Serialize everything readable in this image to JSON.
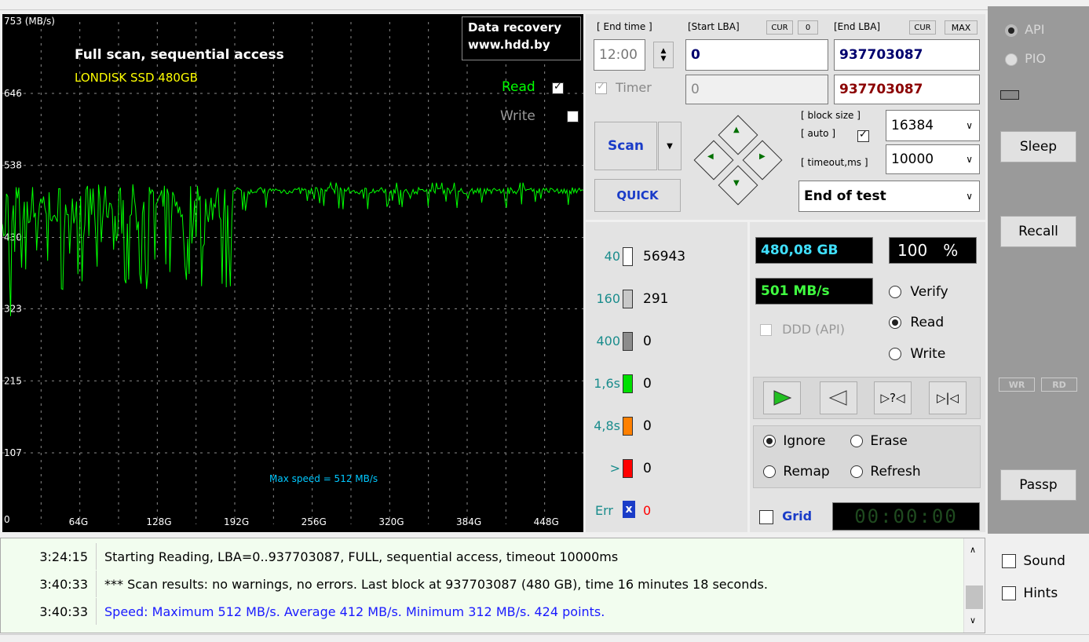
{
  "graph": {
    "y_unit_label": "753 (MB/s)",
    "y_ticks": [
      "646",
      "538",
      "430",
      "323",
      "215",
      "107",
      "0"
    ],
    "x_ticks": [
      "64G",
      "128G",
      "192G",
      "256G",
      "320G",
      "384G",
      "448G"
    ],
    "title": "Full scan, sequential access",
    "drive": "LONDISK SSD 480GB",
    "brand_line1": "Data recovery",
    "brand_line2": "www.hdd.by",
    "read_label": "Read",
    "write_label": "Write",
    "read_checked": true,
    "write_checked": false,
    "max_speed_text": "Max speed = 512 MB/s",
    "colors": {
      "line": "#00ff00",
      "grid": "#8a8a8a",
      "title": "#ffffff",
      "drive": "#ffff00",
      "maxspeed": "#00c8ff"
    }
  },
  "chart_data": {
    "type": "line",
    "xlim": [
      0,
      480
    ],
    "ylim": [
      0,
      753
    ],
    "max_speed": 512,
    "average_speed": 412,
    "min_speed": 312,
    "points": 424
  },
  "controls": {
    "end_time_label": "[ End time ]",
    "end_time_value": "12:00",
    "timer_label": "Timer",
    "start_lba_label": "[Start LBA]",
    "start_lba_cur": "CUR",
    "start_lba_zero": "0",
    "start_lba_value": "0",
    "start_lba_timer_value": "0",
    "end_lba_label": "[End LBA]",
    "end_lba_cur": "CUR",
    "end_lba_max": "MAX",
    "end_lba_value": "937703087",
    "end_lba_value2": "937703087",
    "block_size_label": "[ block size ]",
    "auto_label": "[ auto ]",
    "timeout_label": "[ timeout,ms ]",
    "block_size_value": "16384",
    "timeout_value": "10000",
    "scan_label": "Scan",
    "quick_label": "QUICK",
    "end_mode": "End of test"
  },
  "blocks": [
    {
      "label": "40",
      "count": "56943",
      "color": "#ffffff"
    },
    {
      "label": "160",
      "count": "291",
      "color": "#c8c8c8"
    },
    {
      "label": "400",
      "count": "0",
      "color": "#8c8c8c"
    },
    {
      "label": "1,6s",
      "count": "0",
      "color": "#00e000"
    },
    {
      "label": "4,8s",
      "count": "0",
      "color": "#ff8000"
    },
    {
      "label": ">",
      "count": "0",
      "color": "#ff0000"
    }
  ],
  "err": {
    "label": "Err",
    "count": "0"
  },
  "status": {
    "size": "480,08 GB",
    "percent": "100",
    "percent_sign": "%",
    "speed": "501 MB/s",
    "ddd_label": "DDD (API)",
    "verify_label": "Verify",
    "read_label": "Read",
    "write_label": "Write",
    "ignore_label": "Ignore",
    "erase_label": "Erase",
    "remap_label": "Remap",
    "refresh_label": "Refresh",
    "grid_label": "Grid",
    "timer_display": "00:00:00"
  },
  "right_panel": {
    "api_label": "API",
    "pio_label": "PIO",
    "sleep_label": "Sleep",
    "recall_label": "Recall",
    "wr_label": "WR",
    "rd_label": "RD",
    "passp_label": "Passp",
    "sound_label": "Sound",
    "hints_label": "Hints"
  },
  "log": [
    {
      "time": "3:24:15",
      "msg": "Starting Reading, LBA=0..937703087, FULL, sequential access, timeout 10000ms",
      "color": "#000000"
    },
    {
      "time": "3:40:33",
      "msg": "*** Scan results: no warnings, no errors. Last block at 937703087 (480 GB), time 16 minutes 18 seconds.",
      "color": "#000000"
    },
    {
      "time": "3:40:33",
      "msg": "Speed: Maximum 512 MB/s. Average 412 MB/s. Minimum 312 MB/s. 424 points.",
      "color": "#1a1aff"
    }
  ]
}
